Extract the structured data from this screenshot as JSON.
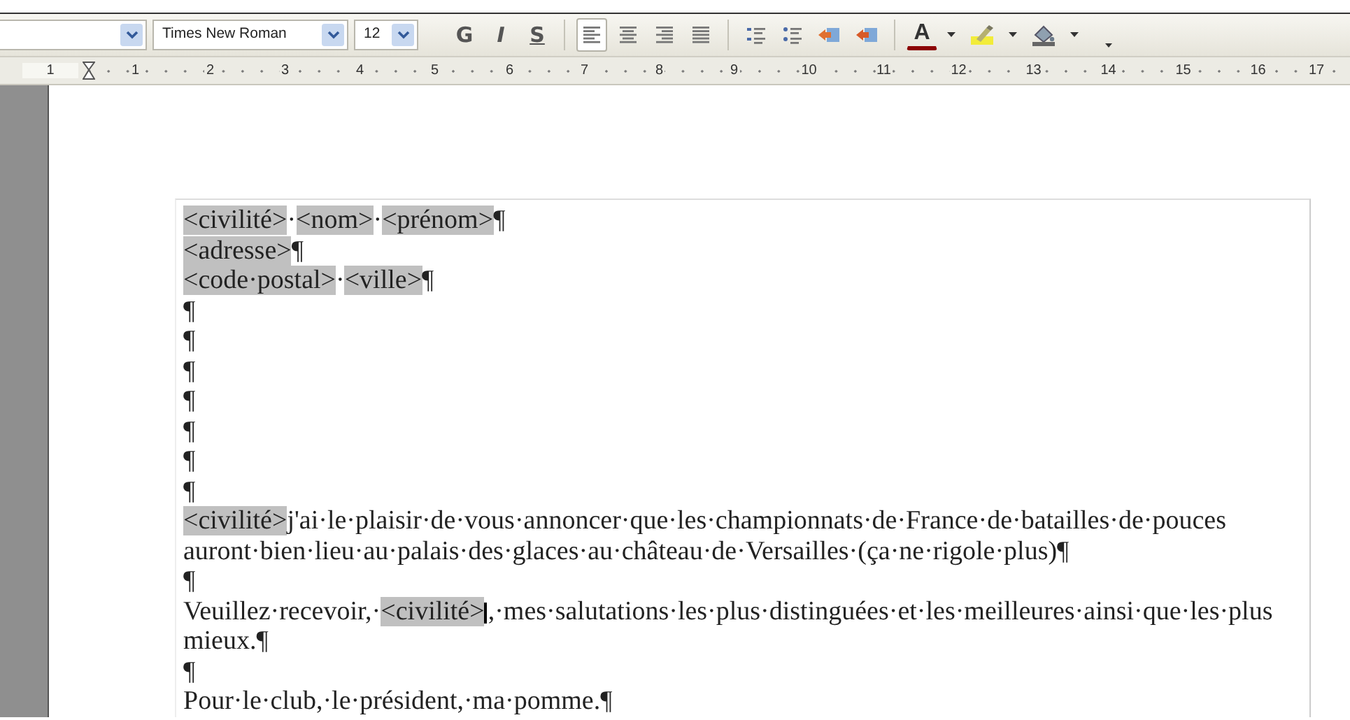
{
  "toolbar": {
    "font_name": "Times New Roman",
    "font_size": "12",
    "buttons": [
      {
        "kind": "bold",
        "label": "G"
      },
      {
        "kind": "italic",
        "label": "I"
      },
      {
        "kind": "underline",
        "label": "S"
      },
      {
        "kind": "separator"
      },
      {
        "kind": "align-left",
        "selected": true
      },
      {
        "kind": "align-center",
        "selected": false
      },
      {
        "kind": "align-right",
        "selected": false
      },
      {
        "kind": "justify",
        "selected": false
      },
      {
        "kind": "separator"
      },
      {
        "kind": "numbered-list"
      },
      {
        "kind": "bullet-list"
      },
      {
        "kind": "indent-decrease"
      },
      {
        "kind": "indent-increase"
      },
      {
        "kind": "separator"
      },
      {
        "kind": "font-color",
        "label": "A"
      },
      {
        "kind": "highlight"
      },
      {
        "kind": "background-color"
      },
      {
        "kind": "more"
      }
    ]
  },
  "ruler": {
    "left_labels": [
      "1"
    ],
    "labels": [
      "1",
      "2",
      "3",
      "4",
      "5",
      "6",
      "7",
      "8",
      "9",
      "10",
      "11",
      "12",
      "13",
      "14",
      "15",
      "16",
      "17"
    ]
  },
  "document": {
    "lines": [
      [
        {
          "text": "<civilité>",
          "field": true
        },
        {
          "text": "·",
          "field": false
        },
        {
          "text": "<nom>",
          "field": true
        },
        {
          "text": "·",
          "field": false
        },
        {
          "text": "<prénom>",
          "field": true
        },
        {
          "text": "¶",
          "field": false
        }
      ],
      [
        {
          "text": "<adresse>",
          "field": true
        },
        {
          "text": "¶",
          "field": false
        }
      ],
      [
        {
          "text": "<code·postal>",
          "field": true
        },
        {
          "text": "·",
          "field": false
        },
        {
          "text": "<ville>",
          "field": true
        },
        {
          "text": "¶",
          "field": false
        }
      ],
      [
        {
          "text": "¶",
          "field": false
        }
      ],
      [
        {
          "text": "¶",
          "field": false
        }
      ],
      [
        {
          "text": "¶",
          "field": false
        }
      ],
      [
        {
          "text": "¶",
          "field": false
        }
      ],
      [
        {
          "text": "¶",
          "field": false
        }
      ],
      [
        {
          "text": "¶",
          "field": false
        }
      ],
      [
        {
          "text": "¶",
          "field": false
        }
      ],
      [
        {
          "text": "<civilité>",
          "field": true
        },
        {
          "text": "j'ai·le·plaisir·de·vous·annoncer·que·les·championnats·de·France·de·batailles·de·pouces",
          "field": false
        }
      ],
      [
        {
          "text": "auront·bien·lieu·au·palais·des·glaces·au·château·de·Versailles·(ça·ne·rigole·plus)¶",
          "field": false
        }
      ],
      [
        {
          "text": "¶",
          "field": false
        }
      ],
      [
        {
          "text": "Veuillez·recevoir,·",
          "field": false
        },
        {
          "text": "<civilité>",
          "field": true,
          "cursor": true
        },
        {
          "text": ",·mes·salutations·les·plus·distinguées·et·les·meilleures·ainsi·que·les·plus",
          "field": false
        }
      ],
      [
        {
          "text": "mieux.¶",
          "field": false
        }
      ],
      [
        {
          "text": "¶",
          "field": false
        }
      ],
      [
        {
          "text": "Pour·le·club,·le·président,·ma·pomme.¶",
          "field": false
        }
      ]
    ]
  }
}
